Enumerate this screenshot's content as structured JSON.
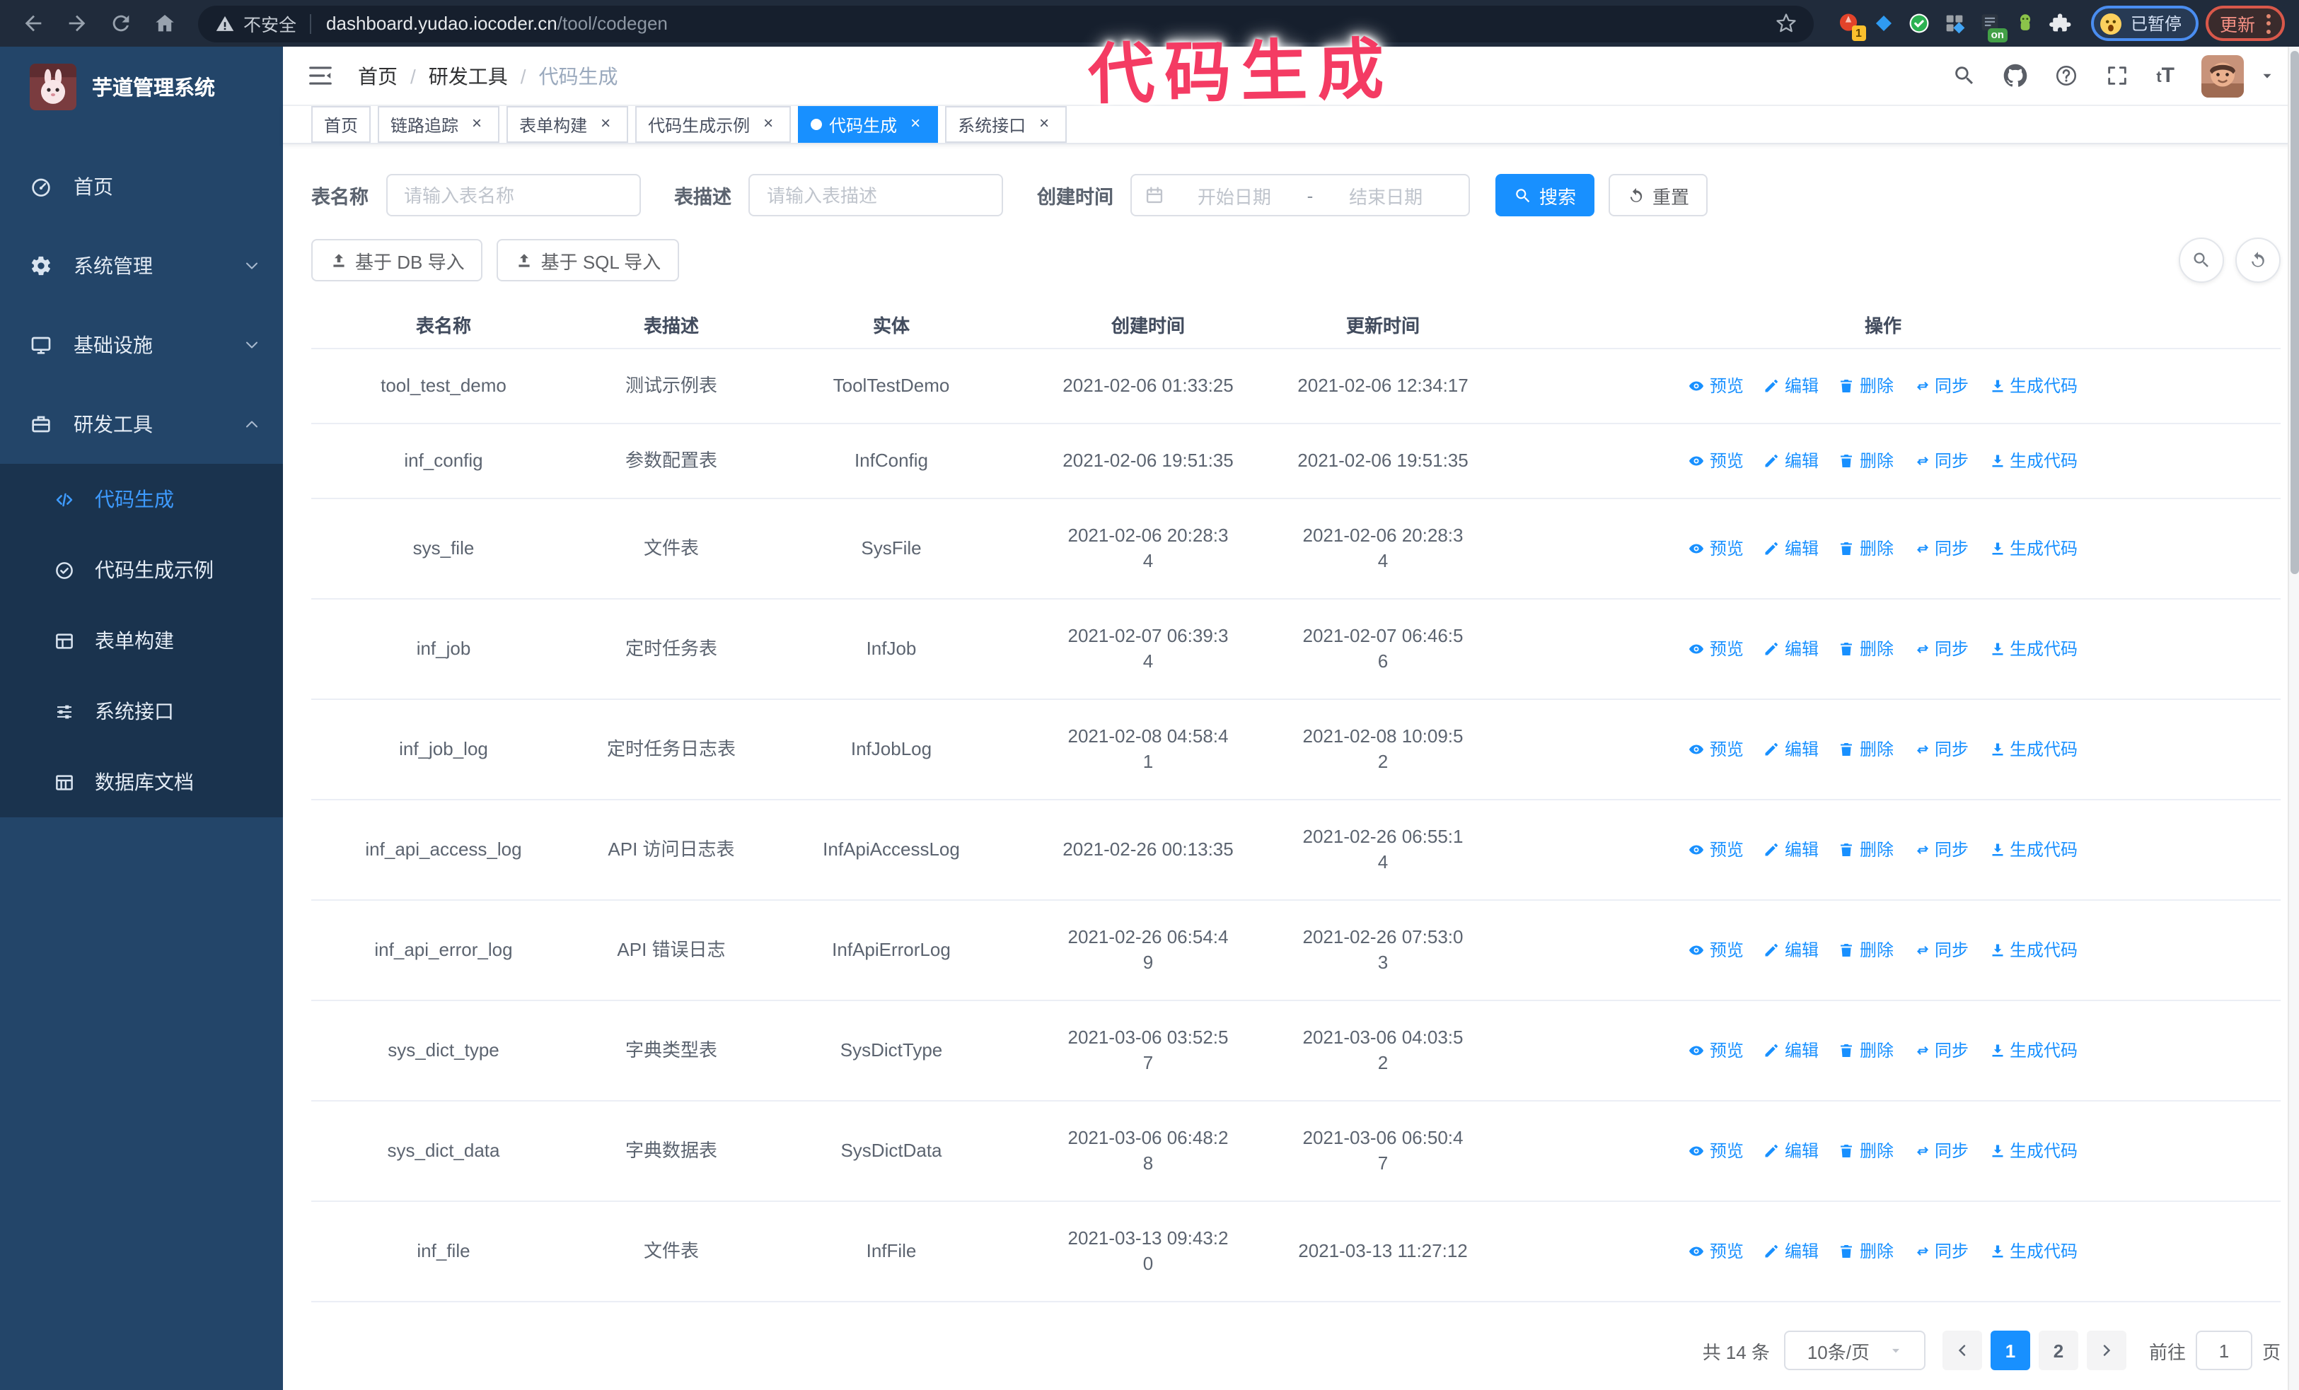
{
  "browser": {
    "security_label": "不安全",
    "url_host": "dashboard.yudao.iocoder.cn",
    "url_path": "/tool/codegen",
    "extension_count_badge": "1",
    "extension_on_badge": "on",
    "paused_badge": "已暂停",
    "update_button": "更新"
  },
  "overlay": {
    "text": "代码生成",
    "color": "#f43b63"
  },
  "sidebar": {
    "title": "芋道管理系统",
    "items": [
      {
        "label": "首页",
        "icon": "dashboard-icon",
        "arrow": ""
      },
      {
        "label": "系统管理",
        "icon": "gear-icon",
        "arrow": "down"
      },
      {
        "label": "基础设施",
        "icon": "monitor-icon",
        "arrow": "down"
      },
      {
        "label": "研发工具",
        "icon": "toolbox-icon",
        "arrow": "up"
      }
    ],
    "submenu": [
      {
        "label": "代码生成",
        "icon": "code-icon",
        "active": true
      },
      {
        "label": "代码生成示例",
        "icon": "check-badge-icon",
        "active": false
      },
      {
        "label": "表单构建",
        "icon": "form-icon",
        "active": false
      },
      {
        "label": "系统接口",
        "icon": "sliders-icon",
        "active": false
      },
      {
        "label": "数据库文档",
        "icon": "db-table-icon",
        "active": false
      }
    ]
  },
  "header": {
    "breadcrumb": [
      "首页",
      "研发工具",
      "代码生成"
    ]
  },
  "tags": [
    {
      "label": "首页",
      "closable": false,
      "active": false
    },
    {
      "label": "链路追踪",
      "closable": true,
      "active": false
    },
    {
      "label": "表单构建",
      "closable": true,
      "active": false
    },
    {
      "label": "代码生成示例",
      "closable": true,
      "active": false
    },
    {
      "label": "代码生成",
      "closable": true,
      "active": true
    },
    {
      "label": "系统接口",
      "closable": true,
      "active": false
    }
  ],
  "filters": {
    "table_name_label": "表名称",
    "table_name_placeholder": "请输入表名称",
    "table_desc_label": "表描述",
    "table_desc_placeholder": "请输入表描述",
    "create_time_label": "创建时间",
    "date_start_placeholder": "开始日期",
    "date_separator": "-",
    "date_end_placeholder": "结束日期",
    "search_label": "搜索",
    "reset_label": "重置"
  },
  "toolbar": {
    "import_db_label": "基于 DB 导入",
    "import_sql_label": "基于 SQL 导入"
  },
  "table": {
    "columns": [
      "表名称",
      "表描述",
      "实体",
      "创建时间",
      "更新时间",
      "操作"
    ],
    "action_labels": [
      "预览",
      "编辑",
      "删除",
      "同步",
      "生成代码"
    ],
    "action_icons": [
      "eye-icon",
      "edit-icon",
      "delete-icon",
      "sync-icon",
      "download-icon"
    ],
    "action_names": [
      "preview-link",
      "edit-link",
      "delete-link",
      "sync-link",
      "generate-code-link"
    ],
    "rows": [
      {
        "name": "tool_test_demo",
        "desc": "测试示例表",
        "entity": "ToolTestDemo",
        "created": "2021-02-06 01:33:25",
        "updated": "2021-02-06 12:34:17"
      },
      {
        "name": "inf_config",
        "desc": "参数配置表",
        "entity": "InfConfig",
        "created": "2021-02-06 19:51:35",
        "updated": "2021-02-06 19:51:35"
      },
      {
        "name": "sys_file",
        "desc": "文件表",
        "entity": "SysFile",
        "created": "2021-02-06 20:28:3\n4",
        "updated": "2021-02-06 20:28:3\n4"
      },
      {
        "name": "inf_job",
        "desc": "定时任务表",
        "entity": "InfJob",
        "created": "2021-02-07 06:39:3\n4",
        "updated": "2021-02-07 06:46:5\n6"
      },
      {
        "name": "inf_job_log",
        "desc": "定时任务日志表",
        "entity": "InfJobLog",
        "created": "2021-02-08 04:58:4\n1",
        "updated": "2021-02-08 10:09:5\n2"
      },
      {
        "name": "inf_api_access_log",
        "desc": "API 访问日志表",
        "entity": "InfApiAccessLog",
        "created": "2021-02-26 00:13:35",
        "updated": "2021-02-26 06:55:1\n4"
      },
      {
        "name": "inf_api_error_log",
        "desc": "API 错误日志",
        "entity": "InfApiErrorLog",
        "created": "2021-02-26 06:54:4\n9",
        "updated": "2021-02-26 07:53:0\n3"
      },
      {
        "name": "sys_dict_type",
        "desc": "字典类型表",
        "entity": "SysDictType",
        "created": "2021-03-06 03:52:5\n7",
        "updated": "2021-03-06 04:03:5\n2"
      },
      {
        "name": "sys_dict_data",
        "desc": "字典数据表",
        "entity": "SysDictData",
        "created": "2021-03-06 06:48:2\n8",
        "updated": "2021-03-06 06:50:4\n7"
      },
      {
        "name": "inf_file",
        "desc": "文件表",
        "entity": "InfFile",
        "created": "2021-03-13 09:43:2\n0",
        "updated": "2021-03-13 11:27:12"
      }
    ]
  },
  "pagination": {
    "total": "共 14 条",
    "page_size": "10条/页",
    "pages": [
      "1",
      "2"
    ],
    "active_page": "1",
    "goto_label": "前往",
    "goto_value": "1",
    "goto_suffix": "页"
  }
}
